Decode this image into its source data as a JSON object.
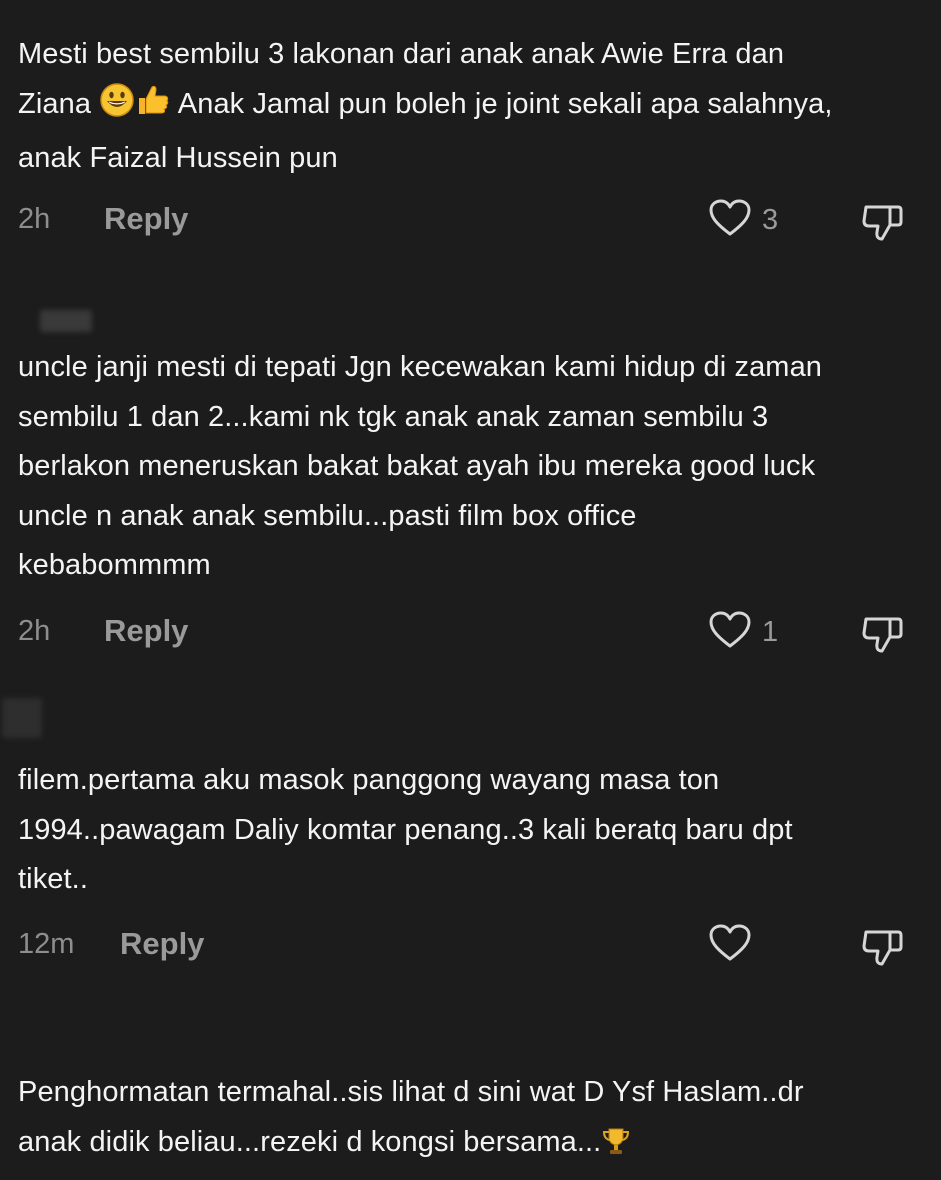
{
  "comments": [
    {
      "lines": [
        "Mesti best sembilu 3 lakonan dari anak anak Awie Erra dan",
        "Ziana",
        "Anak Jamal pun boleh je joint sekali apa salahnya,",
        "anak Faizal Hussein pun"
      ],
      "emojis": [
        "grinning-face",
        "thumbs-up"
      ],
      "time": "2h",
      "reply_label": "Reply",
      "likes": "3"
    },
    {
      "lines": [
        "uncle janji mesti di tepati Jgn kecewakan kami hidup di zaman",
        "sembilu 1 dan 2...kami nk tgk anak anak zaman sembilu 3",
        "berlakon meneruskan bakat bakat ayah ibu mereka good luck",
        "uncle n anak anak sembilu...pasti film box office",
        "kebabommmm"
      ],
      "time": "2h",
      "reply_label": "Reply",
      "likes": "1"
    },
    {
      "lines": [
        "filem.pertama aku masok panggong wayang masa ton",
        "1994..pawagam Daliy komtar penang..3 kali beratq baru dpt",
        "tiket.."
      ],
      "time": "12m",
      "reply_label": "Reply",
      "likes": ""
    },
    {
      "lines": [
        "Penghormatan termahal..sis lihat d sini wat D Ysf Haslam..dr",
        "anak didik beliau...rezeki d kongsi bersama..."
      ],
      "emojis": [
        "trophy"
      ]
    }
  ],
  "icons": {
    "like": "heart-outline-icon",
    "dislike": "thumbs-down-outline-icon"
  },
  "colors": {
    "background": "#1c1c1c",
    "text": "#f4f4f4",
    "muted": "#8e8e8e"
  }
}
